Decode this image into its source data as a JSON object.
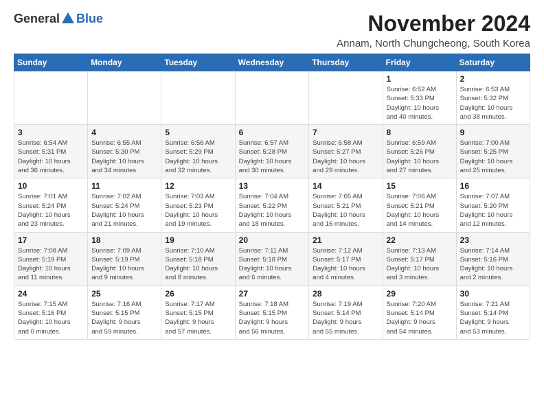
{
  "logo": {
    "general": "General",
    "blue": "Blue"
  },
  "title": "November 2024",
  "subtitle": "Annam, North Chungcheong, South Korea",
  "weekdays": [
    "Sunday",
    "Monday",
    "Tuesday",
    "Wednesday",
    "Thursday",
    "Friday",
    "Saturday"
  ],
  "weeks": [
    [
      {
        "day": "",
        "info": ""
      },
      {
        "day": "",
        "info": ""
      },
      {
        "day": "",
        "info": ""
      },
      {
        "day": "",
        "info": ""
      },
      {
        "day": "",
        "info": ""
      },
      {
        "day": "1",
        "info": "Sunrise: 6:52 AM\nSunset: 5:33 PM\nDaylight: 10 hours\nand 40 minutes."
      },
      {
        "day": "2",
        "info": "Sunrise: 6:53 AM\nSunset: 5:32 PM\nDaylight: 10 hours\nand 38 minutes."
      }
    ],
    [
      {
        "day": "3",
        "info": "Sunrise: 6:54 AM\nSunset: 5:31 PM\nDaylight: 10 hours\nand 36 minutes."
      },
      {
        "day": "4",
        "info": "Sunrise: 6:55 AM\nSunset: 5:30 PM\nDaylight: 10 hours\nand 34 minutes."
      },
      {
        "day": "5",
        "info": "Sunrise: 6:56 AM\nSunset: 5:29 PM\nDaylight: 10 hours\nand 32 minutes."
      },
      {
        "day": "6",
        "info": "Sunrise: 6:57 AM\nSunset: 5:28 PM\nDaylight: 10 hours\nand 30 minutes."
      },
      {
        "day": "7",
        "info": "Sunrise: 6:58 AM\nSunset: 5:27 PM\nDaylight: 10 hours\nand 29 minutes."
      },
      {
        "day": "8",
        "info": "Sunrise: 6:59 AM\nSunset: 5:26 PM\nDaylight: 10 hours\nand 27 minutes."
      },
      {
        "day": "9",
        "info": "Sunrise: 7:00 AM\nSunset: 5:25 PM\nDaylight: 10 hours\nand 25 minutes."
      }
    ],
    [
      {
        "day": "10",
        "info": "Sunrise: 7:01 AM\nSunset: 5:24 PM\nDaylight: 10 hours\nand 23 minutes."
      },
      {
        "day": "11",
        "info": "Sunrise: 7:02 AM\nSunset: 5:24 PM\nDaylight: 10 hours\nand 21 minutes."
      },
      {
        "day": "12",
        "info": "Sunrise: 7:03 AM\nSunset: 5:23 PM\nDaylight: 10 hours\nand 19 minutes."
      },
      {
        "day": "13",
        "info": "Sunrise: 7:04 AM\nSunset: 5:22 PM\nDaylight: 10 hours\nand 18 minutes."
      },
      {
        "day": "14",
        "info": "Sunrise: 7:05 AM\nSunset: 5:21 PM\nDaylight: 10 hours\nand 16 minutes."
      },
      {
        "day": "15",
        "info": "Sunrise: 7:06 AM\nSunset: 5:21 PM\nDaylight: 10 hours\nand 14 minutes."
      },
      {
        "day": "16",
        "info": "Sunrise: 7:07 AM\nSunset: 5:20 PM\nDaylight: 10 hours\nand 12 minutes."
      }
    ],
    [
      {
        "day": "17",
        "info": "Sunrise: 7:08 AM\nSunset: 5:19 PM\nDaylight: 10 hours\nand 11 minutes."
      },
      {
        "day": "18",
        "info": "Sunrise: 7:09 AM\nSunset: 5:19 PM\nDaylight: 10 hours\nand 9 minutes."
      },
      {
        "day": "19",
        "info": "Sunrise: 7:10 AM\nSunset: 5:18 PM\nDaylight: 10 hours\nand 8 minutes."
      },
      {
        "day": "20",
        "info": "Sunrise: 7:11 AM\nSunset: 5:18 PM\nDaylight: 10 hours\nand 6 minutes."
      },
      {
        "day": "21",
        "info": "Sunrise: 7:12 AM\nSunset: 5:17 PM\nDaylight: 10 hours\nand 4 minutes."
      },
      {
        "day": "22",
        "info": "Sunrise: 7:13 AM\nSunset: 5:17 PM\nDaylight: 10 hours\nand 3 minutes."
      },
      {
        "day": "23",
        "info": "Sunrise: 7:14 AM\nSunset: 5:16 PM\nDaylight: 10 hours\nand 2 minutes."
      }
    ],
    [
      {
        "day": "24",
        "info": "Sunrise: 7:15 AM\nSunset: 5:16 PM\nDaylight: 10 hours\nand 0 minutes."
      },
      {
        "day": "25",
        "info": "Sunrise: 7:16 AM\nSunset: 5:15 PM\nDaylight: 9 hours\nand 59 minutes."
      },
      {
        "day": "26",
        "info": "Sunrise: 7:17 AM\nSunset: 5:15 PM\nDaylight: 9 hours\nand 57 minutes."
      },
      {
        "day": "27",
        "info": "Sunrise: 7:18 AM\nSunset: 5:15 PM\nDaylight: 9 hours\nand 56 minutes."
      },
      {
        "day": "28",
        "info": "Sunrise: 7:19 AM\nSunset: 5:14 PM\nDaylight: 9 hours\nand 55 minutes."
      },
      {
        "day": "29",
        "info": "Sunrise: 7:20 AM\nSunset: 5:14 PM\nDaylight: 9 hours\nand 54 minutes."
      },
      {
        "day": "30",
        "info": "Sunrise: 7:21 AM\nSunset: 5:14 PM\nDaylight: 9 hours\nand 53 minutes."
      }
    ]
  ]
}
